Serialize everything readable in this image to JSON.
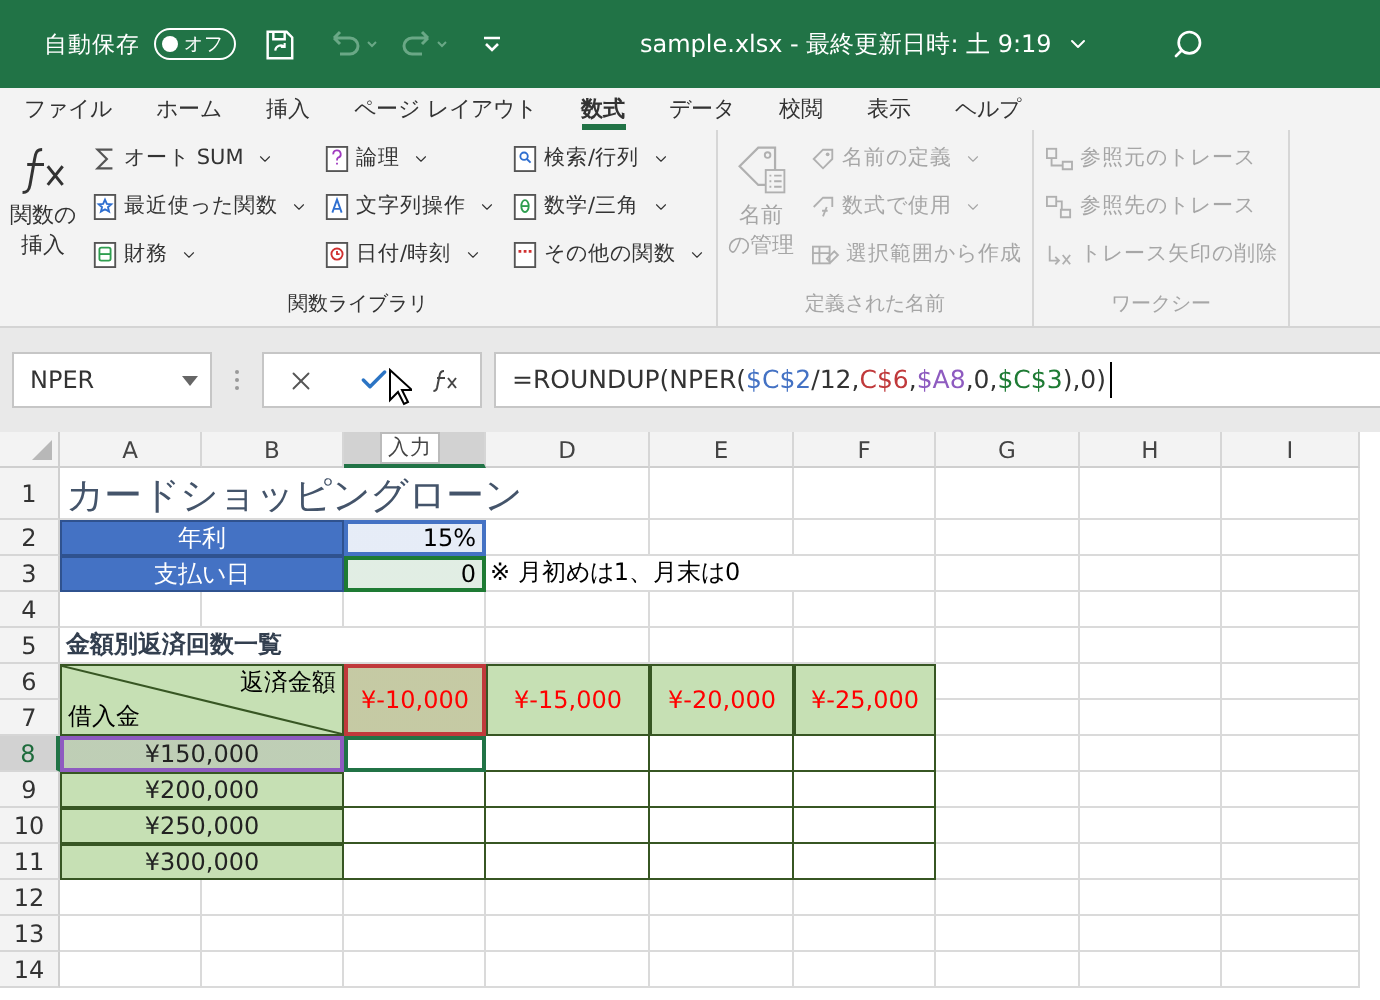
{
  "title_bar": {
    "autosave_label": "自動保存",
    "autosave_toggle": {
      "label": "オフ",
      "on": false
    },
    "title": "sample.xlsx - 最終更新日時: 土 9:19"
  },
  "ribbon_tabs": [
    {
      "label": "ファイル",
      "selected": false
    },
    {
      "label": "ホーム",
      "selected": false
    },
    {
      "label": "挿入",
      "selected": false
    },
    {
      "label": "ページ レイアウト",
      "selected": false
    },
    {
      "label": "数式",
      "selected": true
    },
    {
      "label": "データ",
      "selected": false
    },
    {
      "label": "校閲",
      "selected": false
    },
    {
      "label": "表示",
      "selected": false
    },
    {
      "label": "ヘルプ",
      "selected": false
    }
  ],
  "ribbon_groups": [
    {
      "label": "関数ライブラリ",
      "disabled": false,
      "big_button": [
        "関数の",
        "挿入"
      ],
      "columns": [
        [
          {
            "label": "オート SUM",
            "dropdown": true
          },
          {
            "label": "最近使った関数",
            "dropdown": true
          },
          {
            "label": "財務",
            "dropdown": true
          }
        ],
        [
          {
            "label": "論理",
            "dropdown": true
          },
          {
            "label": "文字列操作",
            "dropdown": true
          },
          {
            "label": "日付/時刻",
            "dropdown": true
          }
        ],
        [
          {
            "label": "検索/行列",
            "dropdown": true
          },
          {
            "label": "数学/三角",
            "dropdown": true
          },
          {
            "label": "その他の関数",
            "dropdown": true
          }
        ]
      ]
    },
    {
      "label": "定義された名前",
      "disabled": true,
      "big_button": [
        "名前",
        "の管理"
      ],
      "columns": [
        [
          {
            "label": "名前の定義",
            "dropdown": true
          },
          {
            "label": "数式で使用",
            "dropdown": true
          },
          {
            "label": "選択範囲から作成",
            "dropdown": false
          }
        ]
      ]
    },
    {
      "label": "ワークシー",
      "disabled": true,
      "columns": [
        [
          {
            "label": "参照元のトレース",
            "dropdown": false
          },
          {
            "label": "参照先のトレース",
            "dropdown": false
          },
          {
            "label": "トレース矢印の削除",
            "dropdown": false
          }
        ]
      ]
    }
  ],
  "formula_bar": {
    "name_box": "NPER",
    "tooltip": "入力",
    "formula": [
      {
        "before": "=ROUNDUP(NPER(",
        "ref": "$C$2",
        "color": "#4472c4"
      },
      {
        "before": "/12,",
        "ref": "C$6",
        "color": "#c0393b"
      },
      {
        "before": ",",
        "ref": "$A8",
        "color": "#8e5bc0"
      },
      {
        "before": ",0,",
        "ref": "$C$3",
        "color": "#1e7b34"
      }
    ],
    "formula_end": "),0)"
  },
  "sheet": {
    "columns": [
      {
        "label": "A",
        "selected": false
      },
      {
        "label": "B",
        "selected": false
      },
      {
        "selected": true
      },
      {
        "label": "D",
        "selected": false
      },
      {
        "label": "E",
        "selected": false
      },
      {
        "label": "F",
        "selected": false
      },
      {
        "label": "G",
        "selected": false
      },
      {
        "label": "H",
        "selected": false
      },
      {
        "label": "I",
        "selected": false
      }
    ],
    "rows": [
      {
        "label": "1",
        "selected": false
      },
      {
        "label": "2",
        "selected": false
      },
      {
        "label": "3",
        "selected": false
      },
      {
        "label": "4",
        "selected": false
      },
      {
        "label": "5",
        "selected": false
      },
      {
        "label": "6",
        "selected": false
      },
      {
        "label": "7",
        "selected": false
      },
      {
        "label": "8",
        "selected": true
      },
      {
        "label": "9",
        "selected": false
      },
      {
        "label": "10",
        "selected": false
      },
      {
        "label": "11",
        "selected": false
      },
      {
        "label": "12",
        "selected": false
      },
      {
        "label": "13",
        "selected": false
      },
      {
        "label": "14",
        "selected": false
      }
    ],
    "cells": [
      {
        "kind": "title",
        "text": "カードショッピングローン"
      },
      {
        "kind": "label",
        "text": "年利"
      },
      {
        "kind": "input",
        "text": "15%",
        "color": "#4472c4"
      },
      {
        "kind": "label",
        "text": "支払い日"
      },
      {
        "kind": "input",
        "text": "0",
        "color": "#1e7b34"
      },
      {
        "kind": "note",
        "text": "※ 月初めは1、月末は0"
      },
      {
        "kind": "heading",
        "text": "金額別返済回数一覧"
      },
      {
        "kind": "corner",
        "top": "返済金額",
        "bottom": "借入金"
      },
      {
        "kind": "amount",
        "text": "¥-10,000",
        "color": "#c0393b"
      },
      {
        "kind": "amount",
        "text": "¥-15,000"
      },
      {
        "kind": "amount",
        "text": "¥-20,000"
      },
      {
        "kind": "amount",
        "text": "¥-25,000"
      },
      {
        "kind": "principal",
        "text": "¥150,000",
        "color": "#8e5bc0"
      },
      {
        "kind": "principal",
        "text": "¥200,000"
      },
      {
        "kind": "principal",
        "text": "¥250,000"
      },
      {
        "kind": "principal",
        "text": "¥300,000"
      }
    ]
  }
}
